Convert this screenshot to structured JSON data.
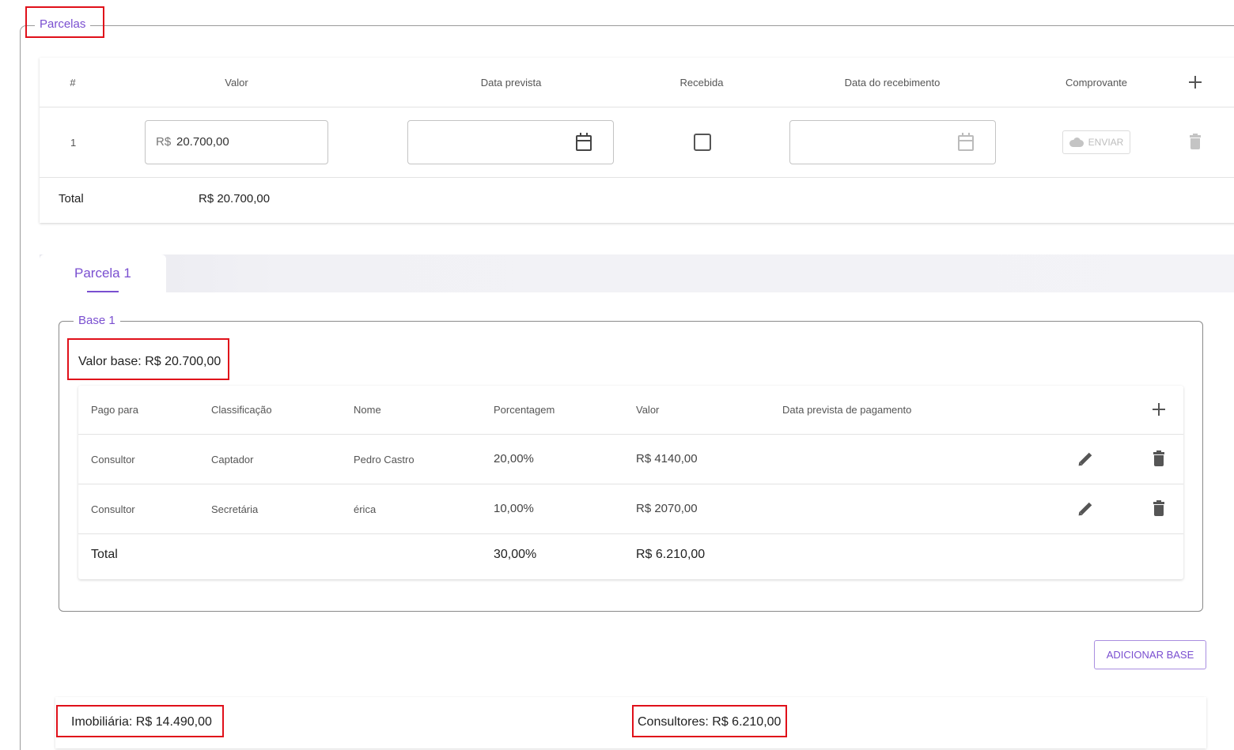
{
  "parcelas": {
    "legend": "Parcelas",
    "headers": {
      "num": "#",
      "valor": "Valor",
      "data_prevista": "Data prevista",
      "recebida": "Recebida",
      "data_recebimento": "Data do recebimento",
      "comprovante": "Comprovante"
    },
    "rows": [
      {
        "num": "1",
        "currency": "R$",
        "valor": "20.700,00",
        "data_prevista": "",
        "recebida": false,
        "data_recebimento": "",
        "enviar_label": "ENVIAR"
      }
    ],
    "total_label": "Total",
    "total_value": "R$ 20.700,00"
  },
  "tabs": [
    {
      "label": "Parcela 1",
      "active": true
    }
  ],
  "base": {
    "legend": "Base 1",
    "valor_base": "Valor base: R$ 20.700,00",
    "headers": {
      "pago_para": "Pago para",
      "classificacao": "Classificação",
      "nome": "Nome",
      "porcentagem": "Porcentagem",
      "valor": "Valor",
      "data_prevista": "Data prevista de pagamento"
    },
    "rows": [
      {
        "pago_para": "Consultor",
        "classificacao": "Captador",
        "nome": "Pedro Castro",
        "porcentagem": "20,00%",
        "valor": "R$ 4140,00",
        "data_prevista": ""
      },
      {
        "pago_para": "Consultor",
        "classificacao": "Secretária",
        "nome": "érica",
        "porcentagem": "10,00%",
        "valor": "R$ 2070,00",
        "data_prevista": ""
      }
    ],
    "total_label": "Total",
    "total_porcentagem": "30,00%",
    "total_valor": "R$ 6.210,00"
  },
  "actions": {
    "adicionar_base": "ADICIONAR BASE"
  },
  "summary": {
    "imobiliaria": "Imobiliária: R$ 14.490,00",
    "consultores": "Consultores: R$ 6.210,00"
  },
  "colors": {
    "accent": "#7a4fd0",
    "highlight": "#e0101a"
  }
}
